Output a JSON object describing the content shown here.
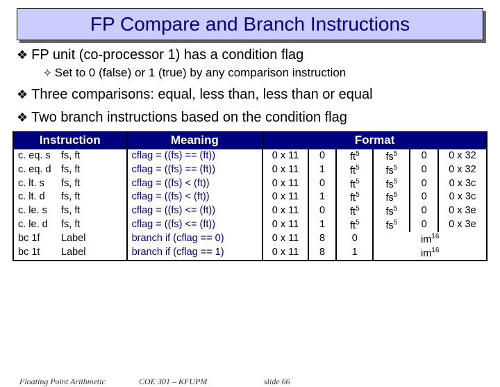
{
  "title": "FP Compare and Branch Instructions",
  "bullets": {
    "b1a": "FP unit (co-processor 1) has a condition flag",
    "b2a": "Set to 0 (false) or 1 (true) by any comparison instruction",
    "b1b": "Three comparisons: equal, less than, less than or equal",
    "b1c": "Two branch instructions based on the condition flag"
  },
  "headers": {
    "instr": "Instruction",
    "mean": "Meaning",
    "fmt": "Format"
  },
  "rows": [
    {
      "op": "c. eq. s",
      "args": "fs, ft",
      "mean": "cflag = ((fs) == (ft))",
      "f": [
        "0 x 11",
        "0",
        "ft",
        "5",
        "fs",
        "5",
        "0",
        "0 x 32"
      ]
    },
    {
      "op": "c. eq. d",
      "args": "fs, ft",
      "mean": "cflag = ((fs) == (ft))",
      "f": [
        "0 x 11",
        "1",
        "ft",
        "5",
        "fs",
        "5",
        "0",
        "0 x 32"
      ]
    },
    {
      "op": "c. lt. s",
      "args": "fs, ft",
      "mean": "cflag = ((fs) <   (ft))",
      "f": [
        "0 x 11",
        "0",
        "ft",
        "5",
        "fs",
        "5",
        "0",
        "0 x 3c"
      ]
    },
    {
      "op": "c. lt. d",
      "args": "fs, ft",
      "mean": "cflag = ((fs) <   (ft))",
      "f": [
        "0 x 11",
        "1",
        "ft",
        "5",
        "fs",
        "5",
        "0",
        "0 x 3c"
      ]
    },
    {
      "op": "c. le. s",
      "args": "fs, ft",
      "mean": "cflag = ((fs) <= (ft))",
      "f": [
        "0 x 11",
        "0",
        "ft",
        "5",
        "fs",
        "5",
        "0",
        "0 x 3e"
      ]
    },
    {
      "op": "c. le. d",
      "args": "fs, ft",
      "mean": "cflag = ((fs) <= (ft))",
      "f": [
        "0 x 11",
        "1",
        "ft",
        "5",
        "fs",
        "5",
        "0",
        "0 x 3e"
      ]
    },
    {
      "op": "bc 1f",
      "args": "Label",
      "mean": "branch if (cflag == 0)",
      "b": [
        "0 x 11",
        "8",
        "0",
        "im",
        "16"
      ]
    },
    {
      "op": "bc 1t",
      "args": "Label",
      "mean": "branch if (cflag == 1)",
      "b": [
        "0 x 11",
        "8",
        "1",
        "im",
        "16"
      ]
    }
  ],
  "footer": {
    "left": "Floating Point Arithmetic",
    "center": "COE 301 – KFUPM",
    "right": "slide 66"
  }
}
